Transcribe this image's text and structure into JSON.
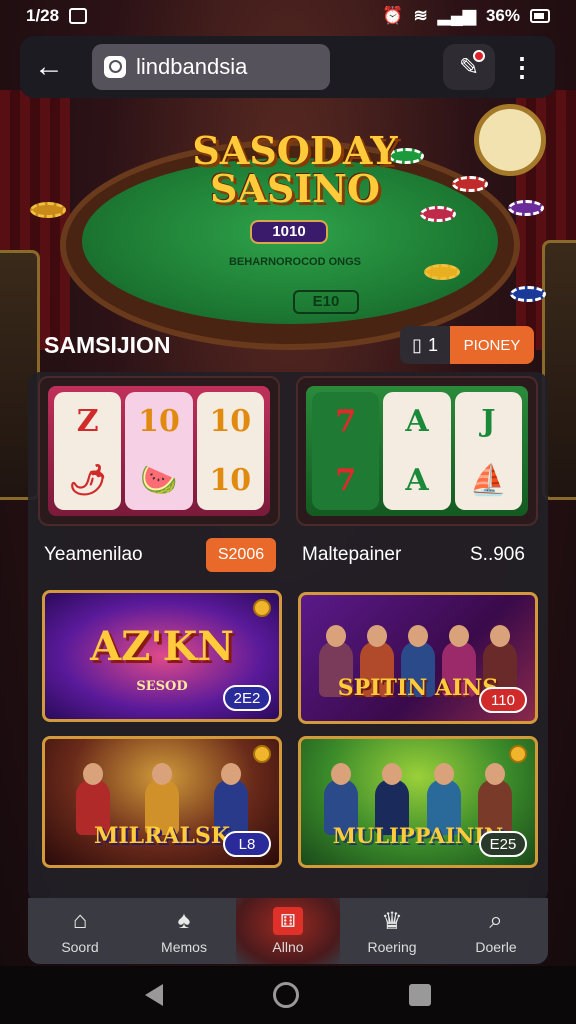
{
  "status_bar": {
    "time": "1/28",
    "battery": "36%"
  },
  "search": {
    "value": "lindbandsia"
  },
  "hero": {
    "title_line1": "SASODAY",
    "title_line2": "SASINO",
    "sub_badge": "1010",
    "felt_text": "BEHARNOROCOD ONGS",
    "felt_badge": "E10"
  },
  "section": {
    "title": "SAMSIJION",
    "page_number": "1",
    "page_button": "PIONEY"
  },
  "slots": [
    {
      "label": "Yeamenilao",
      "price": "S2006",
      "reels": [
        [
          "Z",
          "🌶"
        ],
        [
          "10",
          "🍉"
        ],
        [
          "10",
          "10"
        ]
      ]
    },
    {
      "label": "Maltepainer",
      "price": "S..906",
      "reels": [
        [
          "7",
          "7"
        ],
        [
          "A",
          "A"
        ],
        [
          "J",
          "⛵"
        ]
      ]
    }
  ],
  "games": [
    {
      "title": "AZ'KN",
      "subtitle": "SESOD",
      "badge": "2E2"
    },
    {
      "title": "SPITIN AINS",
      "badge": "110"
    },
    {
      "title": "MILRALSK",
      "badge": "L8"
    },
    {
      "title": "MULIPPAININ",
      "badge": "E25"
    }
  ],
  "bottom_nav": [
    {
      "label": "Soord",
      "icon": "home-icon"
    },
    {
      "label": "Memos",
      "icon": "spade-icon"
    },
    {
      "label": "Allno",
      "icon": "dice-icon",
      "active": true
    },
    {
      "label": "Roering",
      "icon": "crown-icon"
    },
    {
      "label": "Doerle",
      "icon": "search-icon"
    }
  ]
}
